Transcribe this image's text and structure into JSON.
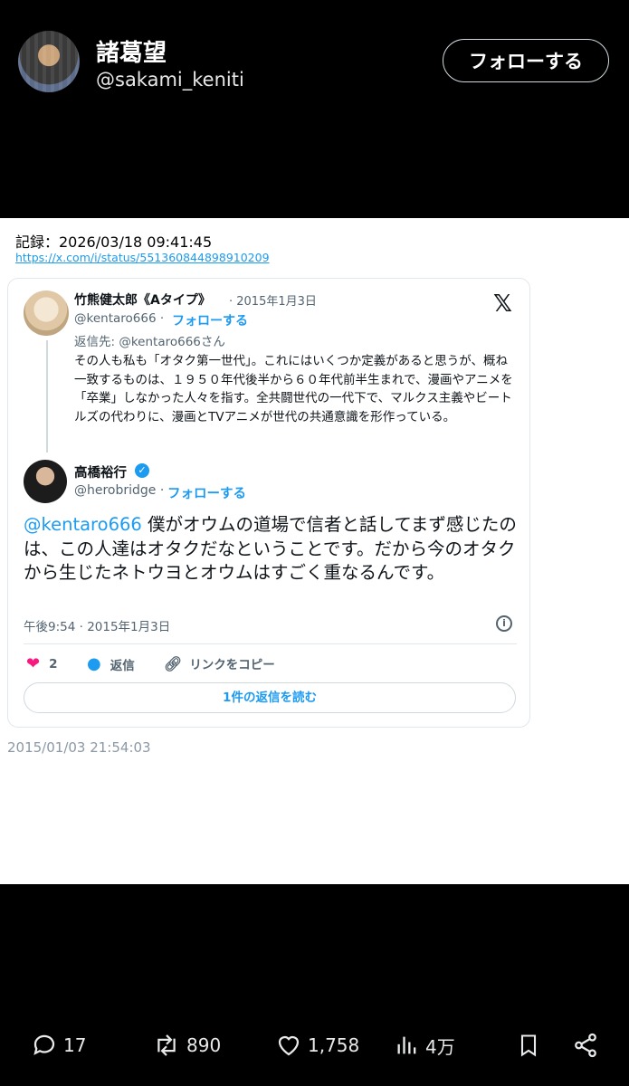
{
  "header": {
    "user_name": "諸葛望",
    "user_handle": "@sakami_keniti",
    "follow_label": "フォローする"
  },
  "screenshot": {
    "record_label": "記録：2026/03/18 09:41:45",
    "url": "https://x.com/i/status/551360844898910209",
    "quoted": {
      "name": "竹熊健太郎《Aタイプ》",
      "date": "· 2015年1月3日",
      "handle": "@kentaro666 ·",
      "follow": "フォローする",
      "reply_to": "返信先: @kentaro666さん",
      "text": "その人も私も「オタク第一世代」。これにはいくつか定義があると思うが、概ね一致するものは、１９５０年代後半から６０年代前半生まれで、漫画やアニメを「卒業」しなかった人々を指す。全共闘世代の一代下で、マルクス主義やビートルズの代わりに、漫画とTVアニメが世代の共通意識を形作っている。"
    },
    "main": {
      "name": "高橋裕行",
      "handle": "@herobridge ·",
      "follow": "フォローする",
      "mention": "@kentaro666",
      "text": " 僕がオウムの道場で信者と話してまず感じたのは、この人達はオタクだなということです。だから今のオタクから生じたネトウヨとオウムはすごく重なるんです。",
      "time": "午後9:54 · 2015年1月3日",
      "like_count": "2",
      "reply_label": "返信",
      "copy_link_label": "リンクをコピー",
      "read_replies_label": "1件の返信を読む"
    },
    "timestamp": "2015/01/03 21:54:03"
  },
  "bottom_bar": {
    "replies": "17",
    "reposts": "890",
    "likes": "1,758",
    "views": "4万"
  },
  "colors": {
    "accent": "#1d9bf0",
    "like": "#f91880"
  }
}
